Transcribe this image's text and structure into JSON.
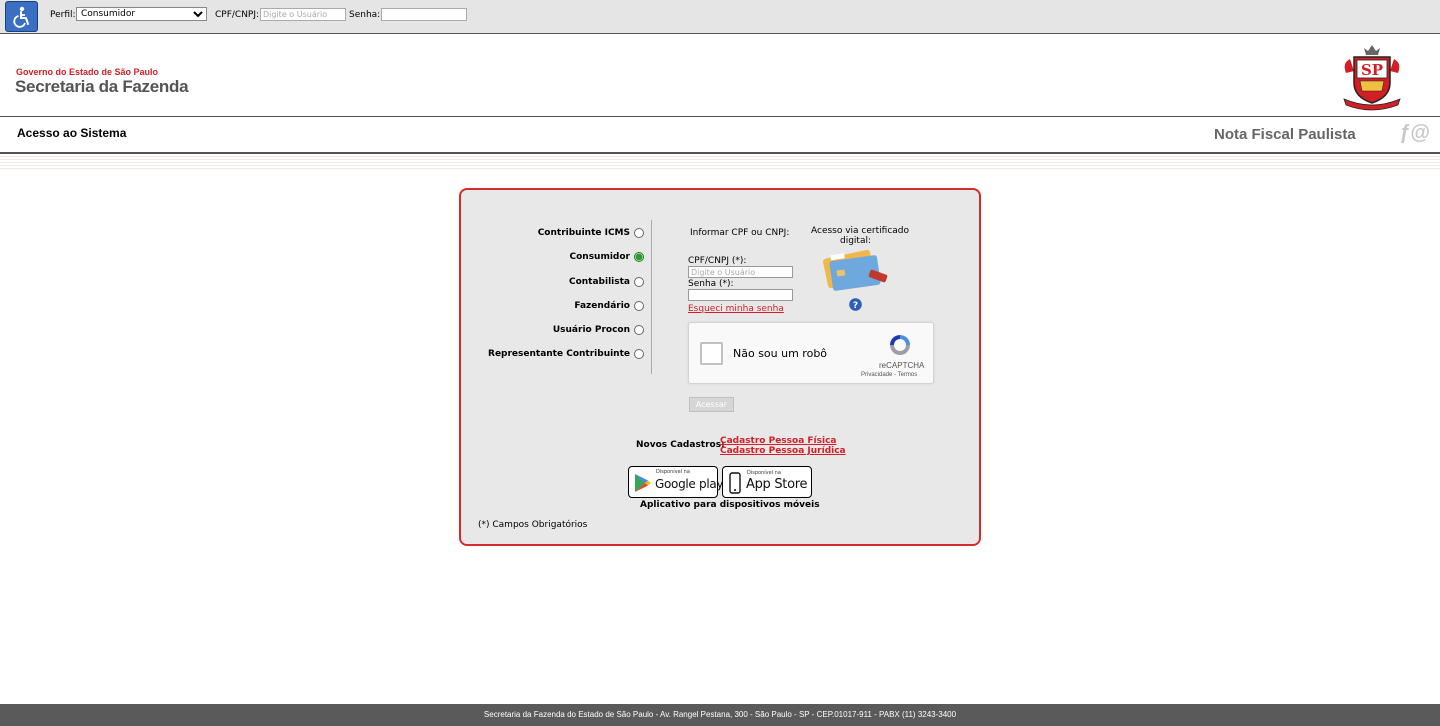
{
  "topbar": {
    "perfil_label": "Perfil:",
    "perfil_value": "Consumidor",
    "cpf_label": "CPF/CNPJ:",
    "cpf_placeholder": "Digite o Usuário",
    "senha_label": "Senha:"
  },
  "header": {
    "gov_line": "Governo do Estado de São Paulo",
    "sef_line": "Secretaria da Fazenda",
    "crest_text": "SP"
  },
  "subheader": {
    "title": "Acesso ao Sistema",
    "app_name": "Nota Fiscal Paulista"
  },
  "login": {
    "profiles": [
      {
        "label": "Contribuinte ICMS",
        "selected": false
      },
      {
        "label": "Consumidor",
        "selected": true
      },
      {
        "label": "Contabilista",
        "selected": false
      },
      {
        "label": "Fazendário",
        "selected": false
      },
      {
        "label": "Usuário Procon",
        "selected": false
      },
      {
        "label": "Representante Contribuinte",
        "selected": false
      }
    ],
    "informar": "Informar CPF ou CNPJ:",
    "certificado_1": "Acesso via certificado",
    "certificado_2": "digital:",
    "cpf_label": "CPF/CNPJ (*):",
    "cpf_placeholder": "Digite o Usuário",
    "senha_label": "Senha (*):",
    "forgot": "Esqueci minha senha",
    "captcha_label": "Não sou um robô",
    "captcha_brand": "reCAPTCHA",
    "captcha_terms": "Privacidade - Termos",
    "submit": "Acessar",
    "novos_label": "Novos Cadastros:",
    "cadastro_pf": "Cadastro Pessoa Física",
    "cadastro_pj": "Cadastro Pessoa Jurídica",
    "google_small": "Disponível na",
    "google_big": "Google play",
    "apple_small": "Disponível na",
    "apple_big": "App Store",
    "apps_caption": "Aplicativo para dispositivos móveis",
    "required_note": "(*) Campos Obrigatórios"
  },
  "footer": {
    "text": "Secretaria da Fazenda do Estado de São Paulo - Av. Rangel Pestana, 300 - São Paulo - SP - CEP.01017-911 - PABX (11) 3243-3400"
  }
}
